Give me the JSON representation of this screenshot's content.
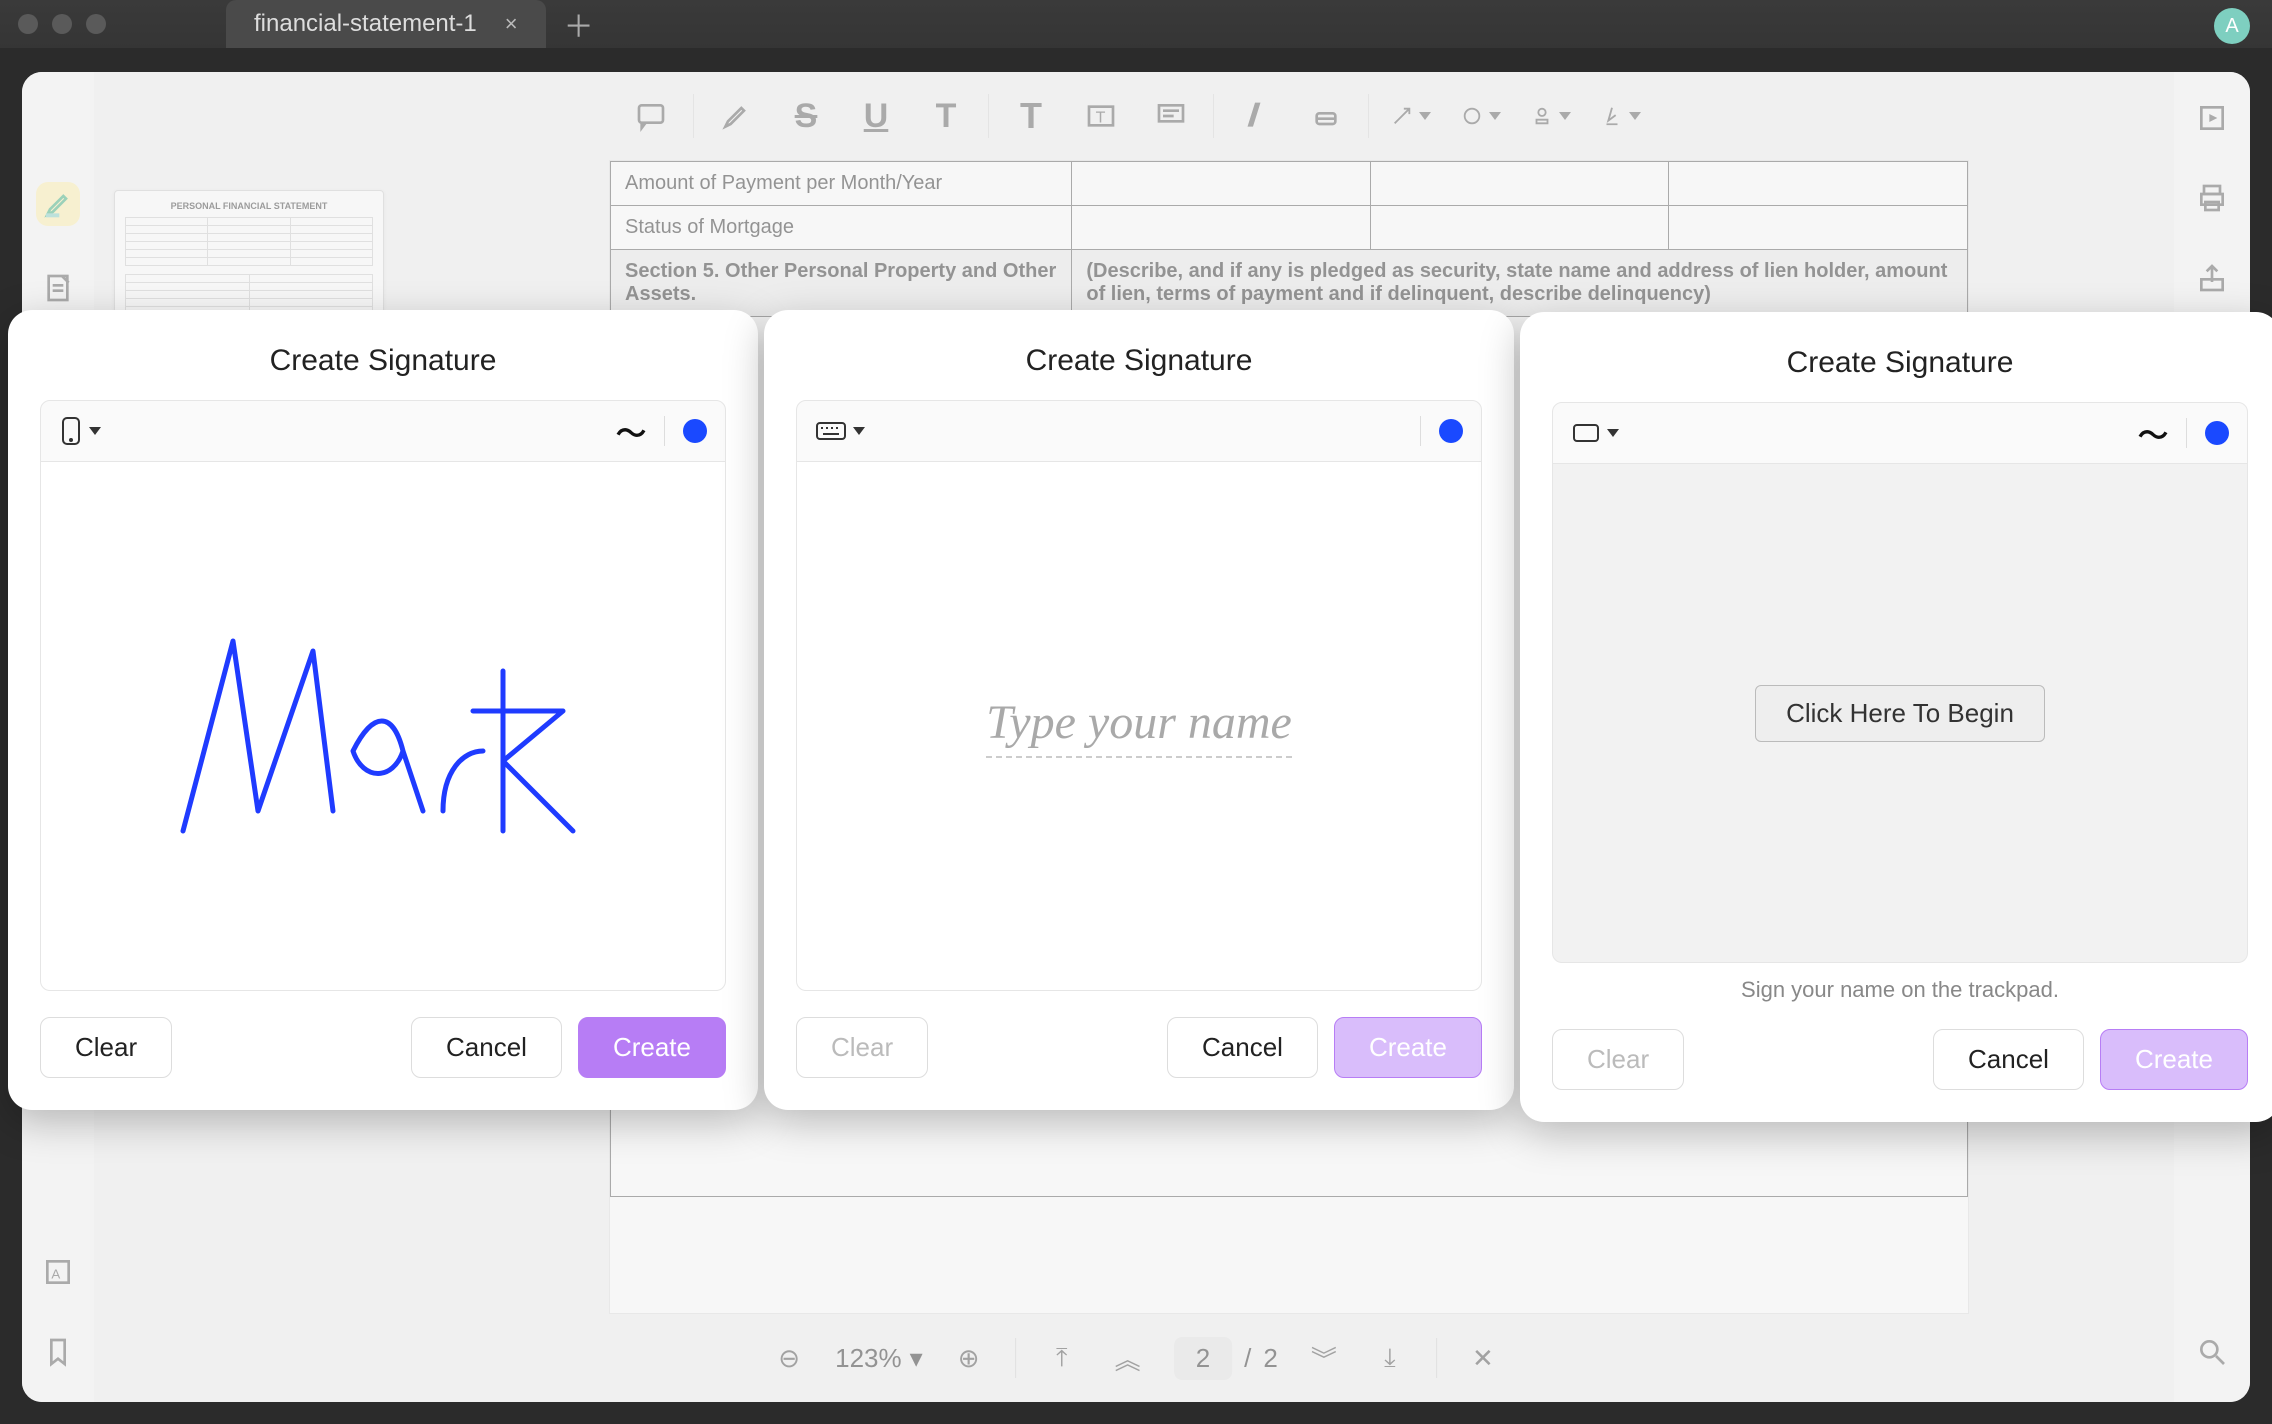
{
  "window": {
    "tab_title": "financial-statement-1",
    "avatar_letter": "A"
  },
  "toolbar": {
    "icons": [
      "comment",
      "highlighter",
      "strikethrough",
      "underline",
      "text-squiggle",
      "text",
      "text-box",
      "text-callout",
      "pencil",
      "eraser",
      "arrow",
      "shape",
      "stamp",
      "signature"
    ]
  },
  "left_sidebar": {
    "items": [
      "highlighter",
      "note"
    ],
    "bottom_items": [
      "ocr",
      "bookmark"
    ]
  },
  "right_sidebar": {
    "items": [
      "play",
      "print",
      "share"
    ],
    "bottom": "search"
  },
  "thumbnail": {
    "doc_title": "PERSONAL FINANCIAL STATEMENT"
  },
  "page": {
    "row1": "Amount of Payment per Month/Year",
    "row2": "Status of Mortgage",
    "section_label": "Section 5. Other Personal Property and Other Assets.",
    "section_desc": "(Describe, and if any is pledged as security, state name and address of lien holder, amount of lien, terms of payment and if delinquent, describe delinquency)"
  },
  "bottombar": {
    "zoom": "123%",
    "page_current": "2",
    "page_sep": "/",
    "page_total": "2"
  },
  "modals": {
    "title": "Create Signature",
    "clear": "Clear",
    "cancel": "Cancel",
    "create": "Create",
    "placeholder_type": "Type your name",
    "begin_button": "Click Here To Begin",
    "trackpad_hint": "Sign your name on the trackpad.",
    "drawn_name": "Mark",
    "sig_color": "#1a49ff"
  }
}
